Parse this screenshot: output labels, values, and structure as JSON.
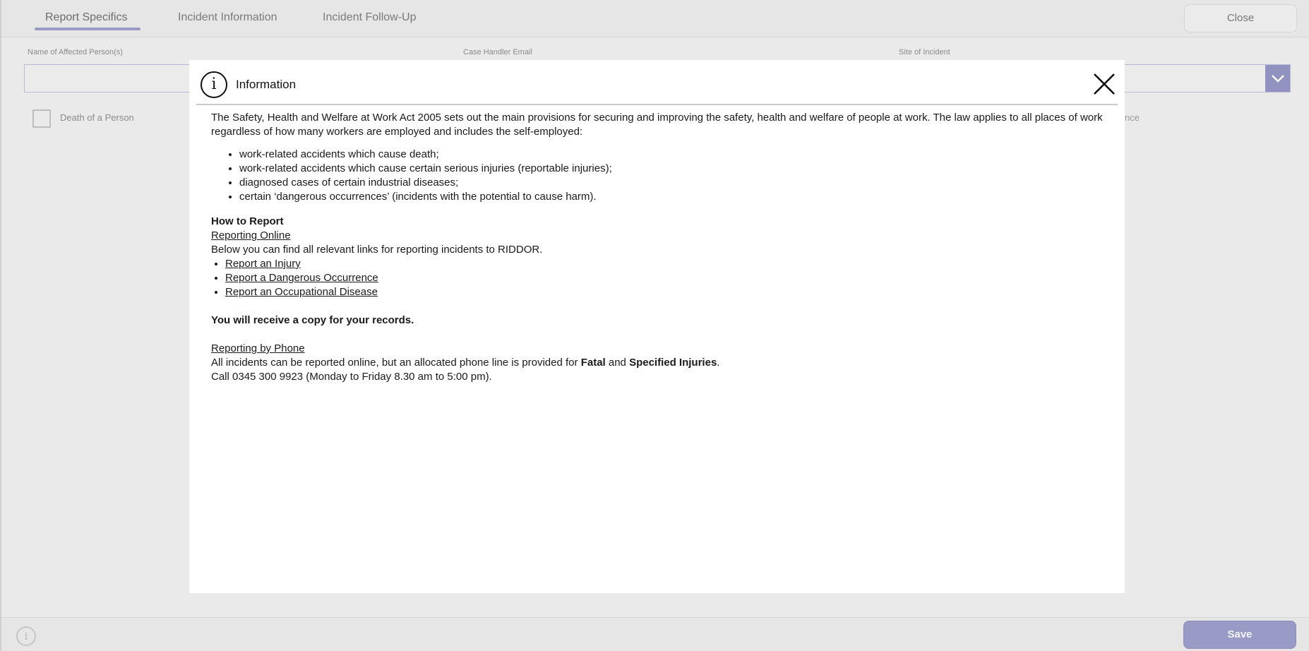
{
  "tabs": [
    {
      "label": "Report Specifics",
      "active": true
    },
    {
      "label": "Incident Information",
      "active": false
    },
    {
      "label": "Incident Follow-Up",
      "active": false
    }
  ],
  "header": {
    "close_label": "Close"
  },
  "form": {
    "fields": [
      {
        "label": "Name of Affected Person(s)",
        "value": ""
      },
      {
        "label": "Case Handler Email",
        "value": ""
      },
      {
        "label": "Site of Incident",
        "value": ""
      }
    ],
    "checkbox": {
      "label": "Death of a Person",
      "checked": false
    },
    "right_fragment": "nce"
  },
  "footer": {
    "info_icon": "i",
    "save_label": "Save"
  },
  "modal": {
    "title": "Information",
    "info_icon": "i",
    "intro": "The Safety, Health and Welfare at Work Act 2005 sets out the main provisions for securing and improving the safety, health and welfare of people at work. The law applies to all places of work regardless of how many workers are employed and includes the self-employed:",
    "bullets": [
      "work-related accidents which cause death;",
      "work-related accidents which cause certain serious injuries (reportable injuries);",
      "diagnosed cases of certain industrial diseases;",
      "certain ‘dangerous occurrences’ (incidents with the potential to cause harm)."
    ],
    "how_heading": "How to Report",
    "online_link": "Reporting Online",
    "online_desc": "Below you can find all relevant links for reporting incidents to RIDDOR.",
    "links": [
      "Report an Injury",
      "Report a Dangerous Occurrence",
      "Report an Occupational Disease"
    ],
    "copy_note": "You will receive a copy for your records.",
    "phone_link": "Reporting by Phone",
    "phone_text_1": "All incidents can be reported online, but an allocated phone line is provided for ",
    "phone_bold_1": "Fatal",
    "phone_text_2": " and ",
    "phone_bold_2": "Specified Injuries",
    "phone_text_3": ".",
    "phone_call": "Call 0345 300 9923 (Monday to Friday 8.30 am to 5:00 pm)."
  },
  "colors": {
    "accent": "#9a9ac6",
    "background": "#eaeaea",
    "modal_background": "#ffffff"
  }
}
